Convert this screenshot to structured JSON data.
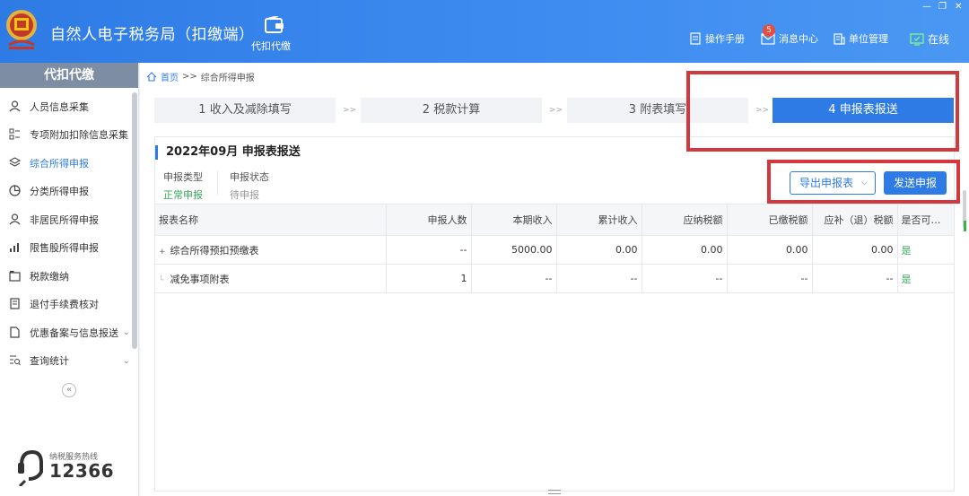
{
  "header": {
    "app_title": "自然人电子税务局（扣缴端）",
    "module_label": "代扣代缴",
    "nav": [
      {
        "label": "操作手册",
        "icon": "manual-icon"
      },
      {
        "label": "消息中心",
        "icon": "mail-icon",
        "badge": "5"
      },
      {
        "label": "单位管理",
        "icon": "building-icon"
      },
      {
        "label": "在线",
        "icon": "online-icon"
      }
    ],
    "window_controls": [
      "minimize",
      "restore",
      "close"
    ]
  },
  "sidebar": {
    "title": "代扣代缴",
    "items": [
      {
        "label": "人员信息采集",
        "icon": "person-icon",
        "active": false
      },
      {
        "label": "专项附加扣除信息采集",
        "icon": "list-icon",
        "active": false
      },
      {
        "label": "综合所得申报",
        "icon": "layers-icon",
        "active": true
      },
      {
        "label": "分类所得申报",
        "icon": "pie-icon",
        "active": false
      },
      {
        "label": "非居民所得申报",
        "icon": "person-icon",
        "active": false
      },
      {
        "label": "限售股所得申报",
        "icon": "bar-chart-icon",
        "active": false
      },
      {
        "label": "税款缴纳",
        "icon": "folder-icon",
        "active": false
      },
      {
        "label": "退付手续费核对",
        "icon": "document-icon",
        "active": false
      },
      {
        "label": "优惠备案与信息报送",
        "icon": "file-icon",
        "active": false,
        "expandable": true
      },
      {
        "label": "查询统计",
        "icon": "query-icon",
        "active": false,
        "expandable": true
      }
    ],
    "hotline_label": "纳税服务热线",
    "hotline_number": "12366"
  },
  "breadcrumb": {
    "home": "首页",
    "sep": ">>",
    "current": "综合所得申报"
  },
  "steps": [
    {
      "label": "1 收入及减除填写",
      "active": false
    },
    {
      "label": "2 税款计算",
      "active": false
    },
    {
      "label": "3 附表填写",
      "active": false
    },
    {
      "label": "4 申报表报送",
      "active": true
    }
  ],
  "step_sep": ">>",
  "panel": {
    "title": "2022年09月  申报表报送",
    "declare_type_label": "申报类型",
    "declare_type_value": "正常申报",
    "declare_status_label": "申报状态",
    "declare_status_value": "待申报",
    "export_label": "导出申报表",
    "send_label": "发送申报"
  },
  "table": {
    "headers": [
      "报表名称",
      "申报人数",
      "本期收入",
      "累计收入",
      "应纳税额",
      "已缴税额",
      "应补（退）税额",
      "是否可申..."
    ],
    "rows": [
      {
        "name": "综合所得预扣预缴表",
        "count": "--",
        "current_income": "5000.00",
        "cumulative_income": "0.00",
        "tax_payable": "0.00",
        "tax_paid": "0.00",
        "tax_due": "0.00",
        "can_declare": "是"
      },
      {
        "name": "减免事项附表",
        "count": "1",
        "current_income": "--",
        "cumulative_income": "--",
        "tax_payable": "--",
        "tax_paid": "--",
        "tax_due": "--",
        "can_declare": "是"
      }
    ]
  },
  "colors": {
    "accent": "#2f7be6",
    "highlight": "#d4383f",
    "yes": "#3aa55d"
  }
}
